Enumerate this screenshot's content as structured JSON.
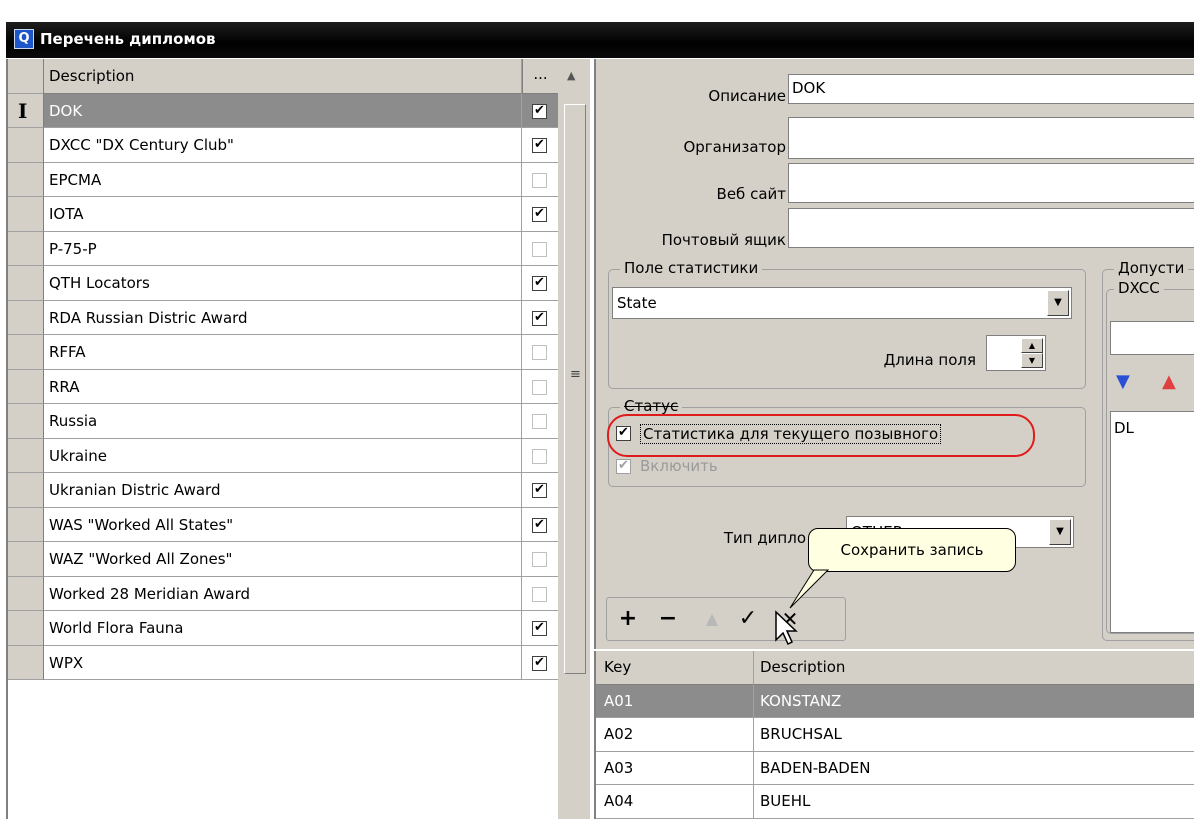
{
  "window": {
    "title": "Перечень дипломов",
    "icon": "app-icon"
  },
  "left_list": {
    "columns": [
      "Description",
      "..."
    ],
    "rows": [
      {
        "description": "DOK",
        "checked": true,
        "selected": true
      },
      {
        "description": "DXCC \"DX Century Club\"",
        "checked": true
      },
      {
        "description": "EPCMA",
        "checked": false
      },
      {
        "description": "IOTA",
        "checked": true
      },
      {
        "description": "P-75-P",
        "checked": false
      },
      {
        "description": "QTH Locators",
        "checked": true
      },
      {
        "description": "RDA Russian Distric Award",
        "checked": true
      },
      {
        "description": "RFFA",
        "checked": false
      },
      {
        "description": "RRA",
        "checked": false
      },
      {
        "description": "Russia",
        "checked": false
      },
      {
        "description": "Ukraine",
        "checked": false
      },
      {
        "description": "Ukranian Distric Award",
        "checked": true
      },
      {
        "description": "WAS \"Worked All States\"",
        "checked": true
      },
      {
        "description": "WAZ \"Worked All Zones\"",
        "checked": false
      },
      {
        "description": "Worked 28 Meridian Award",
        "checked": false
      },
      {
        "description": "World Flora Fauna",
        "checked": true
      },
      {
        "description": "WPX",
        "checked": true
      }
    ]
  },
  "form": {
    "description_label": "Описание",
    "description_value": "DOK",
    "organizer_label": "Организатор",
    "organizer_value": "",
    "website_label": "Веб сайт",
    "website_value": "",
    "mailbox_label": "Почтовый ящик",
    "mailbox_value": "",
    "stats_group_label": "Поле статистики",
    "stats_field_value": "State",
    "field_length_label": "Длина поля",
    "field_length_value": "",
    "status_group_label": "Статус",
    "stats_current_call_label": "Статистика для текущего позывного",
    "stats_current_call_checked": true,
    "enable_label": "Включить",
    "enable_checked": true,
    "award_type_label": "Тип дипло",
    "award_type_value": "OTHER",
    "allowed_group_label": "Допусти",
    "dxcc_group_label": "DXCC",
    "dxcc_list": [
      "DL"
    ]
  },
  "toolbar": {
    "add": "+",
    "remove": "−",
    "up": "▲",
    "save": "✓",
    "cancel": "✕",
    "tooltip": "Сохранить запись"
  },
  "bottom_table": {
    "columns": [
      "Key",
      "Description"
    ],
    "rows": [
      {
        "key": "A01",
        "description": "KONSTANZ",
        "selected": true
      },
      {
        "key": "A02",
        "description": "BRUCHSAL"
      },
      {
        "key": "A03",
        "description": "BADEN-BADEN"
      },
      {
        "key": "A04",
        "description": "BUEHL"
      }
    ]
  },
  "colors": {
    "selection": "#8c8c8c",
    "highlight_ring": "#e01b1b",
    "tooltip_bg": "#ffffe1"
  }
}
